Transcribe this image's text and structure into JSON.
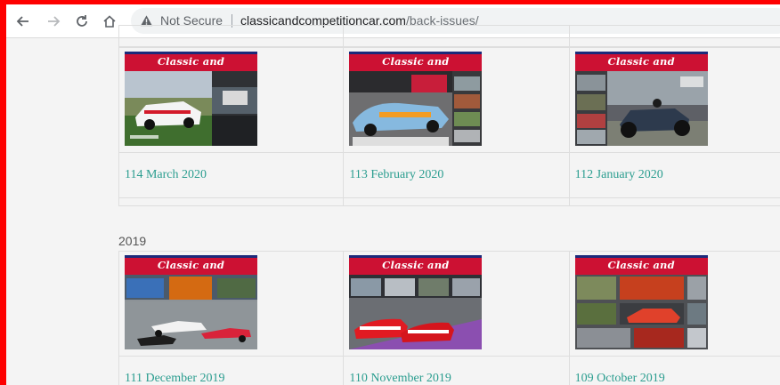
{
  "browser": {
    "security_label": "Not Secure",
    "url_host": "classicandcompetitioncar.com",
    "url_path": "/back-issues/",
    "icons": [
      "back-arrow-icon",
      "forward-arrow-icon",
      "reload-icon",
      "home-icon",
      "warning-triangle-icon"
    ]
  },
  "page": {
    "masthead_text": "Classic and Competition Car",
    "link_color": "#2a9d8f",
    "masthead_color": "#cc1133",
    "sections": [
      {
        "year": "",
        "issues": [
          {
            "label": "114 March 2020"
          },
          {
            "label": "113 February 2020"
          },
          {
            "label": "112 January 2020"
          }
        ]
      },
      {
        "year": "2019",
        "issues": [
          {
            "label": "111 December 2019"
          },
          {
            "label": "110 November 2019"
          },
          {
            "label": "109 October 2019"
          }
        ]
      }
    ]
  }
}
